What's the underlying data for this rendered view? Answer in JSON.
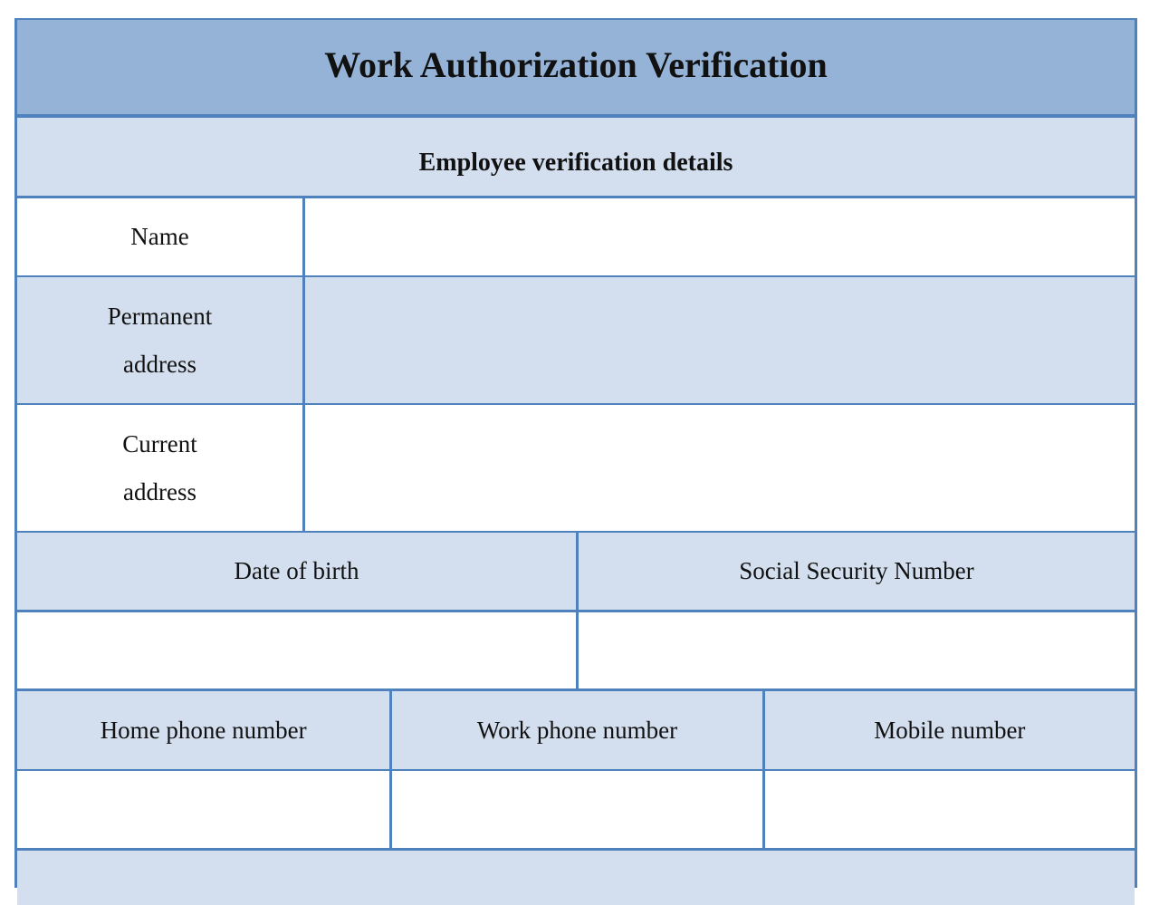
{
  "form": {
    "title": "Work Authorization Verification",
    "section_title": "Employee verification details",
    "fields": {
      "name": {
        "label": "Name",
        "value": ""
      },
      "permanent_address": {
        "label_line1": "Permanent",
        "label_line2": "address",
        "value": ""
      },
      "current_address": {
        "label_line1": "Current",
        "label_line2": "address",
        "value": ""
      },
      "date_of_birth": {
        "label": "Date of birth",
        "value": ""
      },
      "social_security_number": {
        "label": "Social Security Number",
        "value": ""
      },
      "home_phone_number": {
        "label": "Home phone number",
        "value": ""
      },
      "work_phone_number": {
        "label": "Work phone number",
        "value": ""
      },
      "mobile_number": {
        "label": "Mobile number",
        "value": ""
      }
    }
  },
  "colors": {
    "header_fill": "#95b3d7",
    "band_fill": "#d3dfee",
    "border": "#4f81bd"
  }
}
